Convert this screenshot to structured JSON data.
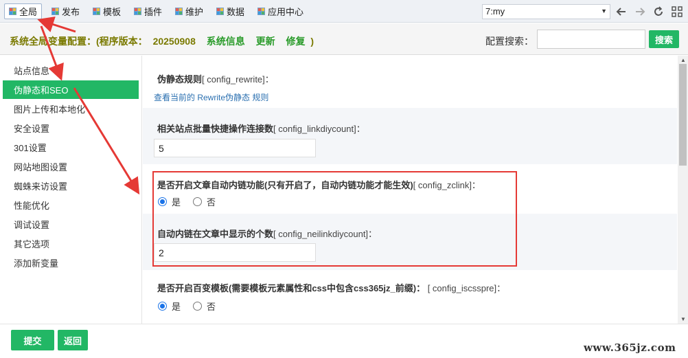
{
  "topnav": {
    "items": [
      {
        "label": "全局",
        "active": true
      },
      {
        "label": "发布",
        "active": false
      },
      {
        "label": "模板",
        "active": false
      },
      {
        "label": "插件",
        "active": false
      },
      {
        "label": "维护",
        "active": false
      },
      {
        "label": "数据",
        "active": false
      },
      {
        "label": "应用中心",
        "active": false
      }
    ],
    "site_select": "7:my",
    "tools": [
      "arrow-left-icon",
      "arrow-right-icon",
      "refresh-icon",
      "grid-icon"
    ]
  },
  "header": {
    "title": "系统全局变量配置：(程序版本：",
    "version": "20250908",
    "links": [
      "系统信息",
      "更新",
      "修复"
    ],
    "closing": ")",
    "search_label": "配置搜索：",
    "search_value": "",
    "search_button": "搜索"
  },
  "sidebar": {
    "items": [
      {
        "label": "站点信息",
        "active": false
      },
      {
        "label": "伪静态和SEO",
        "active": true
      },
      {
        "label": "图片上传和本地化",
        "active": false
      },
      {
        "label": "安全设置",
        "active": false
      },
      {
        "label": "301设置",
        "active": false
      },
      {
        "label": "网站地图设置",
        "active": false
      },
      {
        "label": "蜘蛛来访设置",
        "active": false
      },
      {
        "label": "性能优化",
        "active": false
      },
      {
        "label": "调试设置",
        "active": false
      },
      {
        "label": "其它选项",
        "active": false
      },
      {
        "label": "添加新变量",
        "active": false
      }
    ]
  },
  "main": {
    "rewrite": {
      "label": "伪静态规则",
      "key": "[ config_rewrite]：",
      "link": "查看当前的 Rewrite伪静态 规则"
    },
    "linkdiycount": {
      "label": "相关站点批量快捷操作连接数",
      "key": "[ config_linkdiycount]：",
      "value": "5"
    },
    "zclink": {
      "label": "是否开启文章自动内链功能(只有开启了，自动内链功能才能生效)",
      "key": "[ config_zclink]：",
      "options": [
        "是",
        "否"
      ],
      "selected": "是"
    },
    "neilinkdiycount": {
      "label": "自动内链在文章中显示的个数",
      "key": "[ config_neilinkdiycount]：",
      "value": "2"
    },
    "iscsspre": {
      "label": "是否开启百变模板(需要模板元素属性和css中包含css365jz_前缀)：",
      "key": "[ config_iscsspre]：",
      "options": [
        "是",
        "否"
      ],
      "selected": "是"
    }
  },
  "footer": {
    "submit": "提交",
    "back": "返回",
    "watermark": "www.365jz.com"
  },
  "colors": {
    "accent_green": "#22b765",
    "annotation_red": "#e53935",
    "title_olive": "#7a7a00",
    "link_blue": "#2a6fb0"
  }
}
